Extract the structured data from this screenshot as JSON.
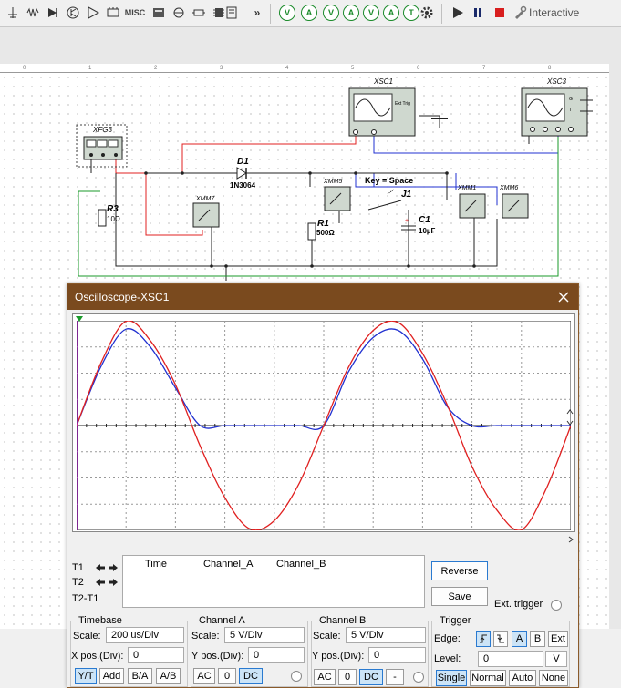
{
  "toolbar": {
    "misc_label": "MISC",
    "interactive_label": "Interactive",
    "meters": [
      "V",
      "A",
      "V",
      "A",
      "V",
      "A",
      "T"
    ],
    "icons": [
      "source-icon",
      "basic-icon",
      "diode-icon",
      "transistor-icon",
      "analog-icon",
      "ttl-icon",
      "cmos-icon",
      "misc-digital-icon",
      "mixed-icon",
      "indicator-icon",
      "power-icon",
      "misc-icon",
      "advanced-peripherals-icon",
      "rf-icon",
      "electromechanical-icon",
      "mcu-icon",
      "more-icon",
      "probe-icon",
      "settings-icon",
      "run-icon",
      "pause-icon",
      "stop-icon",
      "interactive-icon"
    ]
  },
  "schematic": {
    "ruler_marks": [
      "0",
      "1",
      "2",
      "3",
      "4",
      "5",
      "6",
      "7",
      "8"
    ],
    "components": {
      "xfg3": "XFG3",
      "xsc1": "XSC1",
      "xsc1_ext_trig": "Ext Trig",
      "xsc3": "XSC3",
      "d1": "D1",
      "d1_part": "1N3064",
      "xmm5": "XMM5",
      "xmm7": "XMM7",
      "xmm1": "XMM1",
      "xmm6": "XMM6",
      "key": "Key = Space",
      "j1": "J1",
      "r3": "R3",
      "r3_value": "10Ω",
      "r1": "R1",
      "r1_value": "500Ω",
      "c1": "C1",
      "c1_value": "10µF",
      "xsc3_g": "G",
      "xsc3_t": "T"
    }
  },
  "oscilloscope": {
    "title": "Oscilloscope-XSC1",
    "readout": {
      "t1": "T1",
      "t2": "T2",
      "t2t1": "T2-T1",
      "col_time": "Time",
      "col_a": "Channel_A",
      "col_b": "Channel_B"
    },
    "reverse_label": "Reverse",
    "save_label": "Save",
    "ext_trigger_label": "Ext. trigger",
    "timebase": {
      "title": "Timebase",
      "scale_label": "Scale:",
      "scale_value": "200 us/Div",
      "xpos_label": "X pos.(Div):",
      "xpos_value": "0",
      "modes": [
        "Y/T",
        "Add",
        "B/A",
        "A/B"
      ],
      "selected_mode": "Y/T"
    },
    "channel_a": {
      "title": "Channel A",
      "scale_label": "Scale:",
      "scale_value": "5  V/Div",
      "ypos_label": "Y pos.(Div):",
      "ypos_value": "0",
      "coupling": [
        "AC",
        "0",
        "DC"
      ],
      "selected": "DC"
    },
    "channel_b": {
      "title": "Channel B",
      "scale_label": "Scale:",
      "scale_value": "5  V/Div",
      "ypos_label": "Y pos.(Div):",
      "ypos_value": "0",
      "coupling": [
        "AC",
        "0",
        "DC",
        "-"
      ],
      "selected": "DC"
    },
    "trigger": {
      "title": "Trigger",
      "edge_label": "Edge:",
      "sources": [
        "A",
        "B",
        "Ext"
      ],
      "selected_source": "A",
      "level_label": "Level:",
      "level_value": "0",
      "level_unit": "V",
      "modes": [
        "Single",
        "Normal",
        "Auto",
        "None"
      ],
      "selected_mode": "Single"
    },
    "colors": {
      "channel_a": "#e02020",
      "channel_b": "#2030d0",
      "titlebar": "#7a4a1e"
    }
  },
  "chart_data": {
    "type": "line",
    "x": [
      0,
      0.5,
      1,
      1.5,
      2,
      2.5,
      3,
      3.5,
      4,
      4.5,
      5,
      5.5,
      6,
      6.5,
      7,
      7.5,
      8,
      8.5,
      9,
      9.5,
      10
    ],
    "x_unit": "div",
    "y_unit": "div",
    "xlim": [
      0,
      10
    ],
    "ylim": [
      -4,
      4
    ],
    "grid": true,
    "series": [
      {
        "channel": "A",
        "color": "#e02020",
        "values": [
          0,
          2.42,
          3.98,
          3.22,
          1.56,
          -0.78,
          -2.75,
          -3.94,
          -3.63,
          -2.22,
          0,
          2.22,
          3.63,
          3.94,
          2.75,
          0.78,
          -1.56,
          -3.22,
          -3.98,
          -2.42,
          0
        ]
      },
      {
        "channel": "B",
        "color": "#2030d0",
        "values": [
          0,
          2.28,
          3.68,
          2.98,
          1.44,
          0,
          0,
          0,
          0,
          0,
          0,
          2.05,
          3.36,
          3.64,
          2.54,
          0.72,
          0,
          0,
          0,
          0,
          0
        ]
      }
    ]
  }
}
